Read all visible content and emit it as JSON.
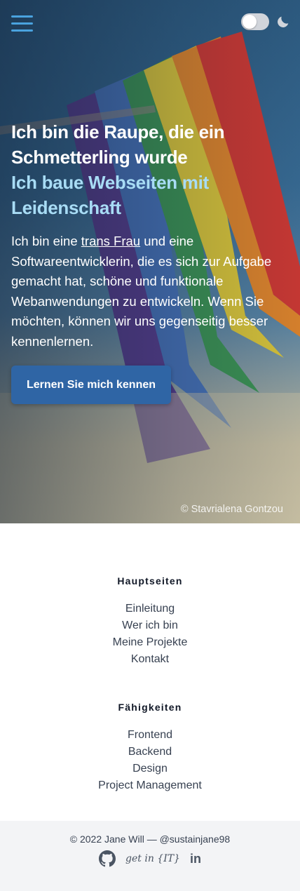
{
  "header": {
    "menu_icon": "hamburger-menu-icon",
    "theme_toggle_icon": "toggle-switch",
    "dark_mode_icon": "moon-icon"
  },
  "hero": {
    "title": "Ich bin die Raupe, die ein Schmetterling wurde",
    "subtitle": "Ich baue Webseiten mit Leidenschaft",
    "intro_before": "Ich bin eine ",
    "intro_link": "trans Frau",
    "intro_after": " und eine Softwareentwicklerin, die es sich zur Aufgabe gemacht hat, schöne und funktionale Webanwendungen zu entwickeln. Wenn Sie möchten, können wir uns gegenseitig besser kennenlernen.",
    "cta_label": "Lernen Sie mich kennen",
    "photo_credit": "© Stavrialena Gontzou",
    "accent_title": "#ffffff",
    "accent_subtitle": "#a8dcf5",
    "cta_color": "#2f65a5"
  },
  "footer": {
    "sections": [
      {
        "heading": "Hauptseiten",
        "links": [
          "Einleitung",
          "Wer ich bin",
          "Meine Projekte",
          "Kontakt"
        ]
      },
      {
        "heading": "Fähigkeiten",
        "links": [
          "Frontend",
          "Backend",
          "Design",
          "Project Management"
        ]
      }
    ],
    "copyright": "© 2022 Jane Will — @sustainjane98",
    "socials": {
      "github_icon": "github-icon",
      "getin_label": "get in {IT}",
      "linkedin_label": "in"
    }
  }
}
